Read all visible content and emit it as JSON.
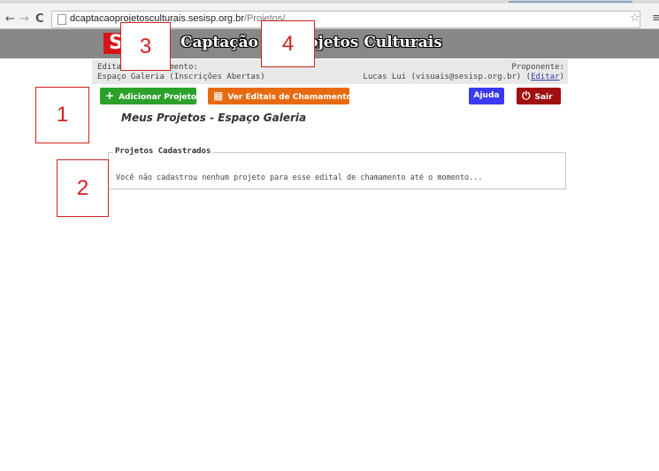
{
  "browser": {
    "back_icon": "←",
    "forward_icon": "→",
    "reload_icon": "C",
    "url_host": "dcaptacaoprojetosculturais.sesisp.org.br",
    "url_path": "/Projetos/",
    "star_icon": "☆",
    "menu_icon": "≡"
  },
  "site": {
    "logo_text": "S",
    "title": "Captação de Projetos Culturais",
    "colors": {
      "header_bg": "#888888",
      "logo_red": "#d8141a"
    }
  },
  "infobar": {
    "edital_label": "Edital de Chamamento:",
    "edital_value": "Espaço Galeria (Inscrições Abertas)",
    "proponente_label": "Proponente:",
    "proponente_value": "Lucas Lui (visuais@sesisp.org.br)",
    "edit_open": "(",
    "edit_link": "Editar",
    "edit_close": ")"
  },
  "toolbar": {
    "add_icon": "+",
    "add_label": "Adicionar Projeto",
    "editais_icon": "▦",
    "editais_label": "Ver Editais de Chamamento",
    "help_label": "Ajuda",
    "exit_icon": "⏻",
    "exit_label": "Sair",
    "colors": {
      "add": "#2ba12b",
      "editais": "#e86a10",
      "help": "#3a3af0",
      "exit": "#a01010"
    }
  },
  "main": {
    "heading": "Meus Projetos - Espaço Galeria",
    "projects_legend": "Projetos Cadastrados",
    "empty_message": "Você não cadastrou nenhum projeto para esse edital de chamamento até o momento..."
  },
  "annotations": [
    "1",
    "2",
    "3",
    "4"
  ]
}
